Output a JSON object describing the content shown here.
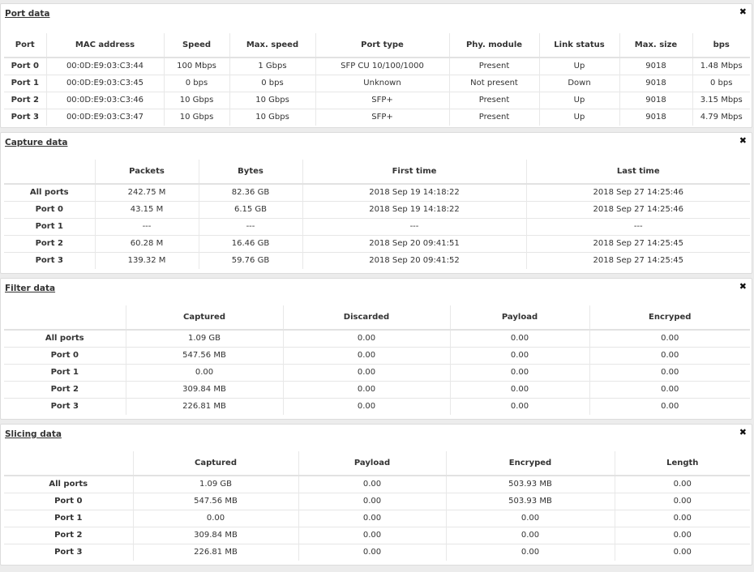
{
  "port_data": {
    "title": "Port data",
    "close": "✖",
    "headers": [
      "Port",
      "MAC address",
      "Speed",
      "Max. speed",
      "Port type",
      "Phy. module",
      "Link status",
      "Max. size",
      "bps"
    ],
    "rows": [
      [
        "Port 0",
        "00:0D:E9:03:C3:44",
        "100 Mbps",
        "1 Gbps",
        "SFP CU 10/100/1000",
        "Present",
        "Up",
        "9018",
        "1.48 Mbps"
      ],
      [
        "Port 1",
        "00:0D:E9:03:C3:45",
        "0 bps",
        "0 bps",
        "Unknown",
        "Not present",
        "Down",
        "9018",
        "0 bps"
      ],
      [
        "Port 2",
        "00:0D:E9:03:C3:46",
        "10 Gbps",
        "10 Gbps",
        "SFP+",
        "Present",
        "Up",
        "9018",
        "3.15 Mbps"
      ],
      [
        "Port 3",
        "00:0D:E9:03:C3:47",
        "10 Gbps",
        "10 Gbps",
        "SFP+",
        "Present",
        "Up",
        "9018",
        "4.79 Mbps"
      ]
    ]
  },
  "capture_data": {
    "title": "Capture data",
    "close": "✖",
    "headers": [
      "",
      "Packets",
      "Bytes",
      "First time",
      "Last time"
    ],
    "rows": [
      [
        "All ports",
        "242.75 M",
        "82.36 GB",
        "2018 Sep 19 14:18:22",
        "2018 Sep 27 14:25:46"
      ],
      [
        "Port 0",
        "43.15 M",
        "6.15 GB",
        "2018 Sep 19 14:18:22",
        "2018 Sep 27 14:25:46"
      ],
      [
        "Port 1",
        "---",
        "---",
        "---",
        "---"
      ],
      [
        "Port 2",
        "60.28 M",
        "16.46 GB",
        "2018 Sep 20 09:41:51",
        "2018 Sep 27 14:25:45"
      ],
      [
        "Port 3",
        "139.32 M",
        "59.76 GB",
        "2018 Sep 20 09:41:52",
        "2018 Sep 27 14:25:45"
      ]
    ]
  },
  "filter_data": {
    "title": "Filter data",
    "close": "✖",
    "headers": [
      "",
      "Captured",
      "Discarded",
      "Payload",
      "Encryped"
    ],
    "rows": [
      [
        "All ports",
        "1.09 GB",
        "0.00",
        "0.00",
        "0.00"
      ],
      [
        "Port 0",
        "547.56 MB",
        "0.00",
        "0.00",
        "0.00"
      ],
      [
        "Port 1",
        "0.00",
        "0.00",
        "0.00",
        "0.00"
      ],
      [
        "Port 2",
        "309.84 MB",
        "0.00",
        "0.00",
        "0.00"
      ],
      [
        "Port 3",
        "226.81 MB",
        "0.00",
        "0.00",
        "0.00"
      ]
    ]
  },
  "slicing_data": {
    "title": "Slicing data",
    "close": "✖",
    "headers": [
      "",
      "Captured",
      "Payload",
      "Encryped",
      "Length"
    ],
    "rows": [
      [
        "All ports",
        "1.09 GB",
        "0.00",
        "503.93 MB",
        "0.00"
      ],
      [
        "Port 0",
        "547.56 MB",
        "0.00",
        "503.93 MB",
        "0.00"
      ],
      [
        "Port 1",
        "0.00",
        "0.00",
        "0.00",
        "0.00"
      ],
      [
        "Port 2",
        "309.84 MB",
        "0.00",
        "0.00",
        "0.00"
      ],
      [
        "Port 3",
        "226.81 MB",
        "0.00",
        "0.00",
        "0.00"
      ]
    ]
  }
}
